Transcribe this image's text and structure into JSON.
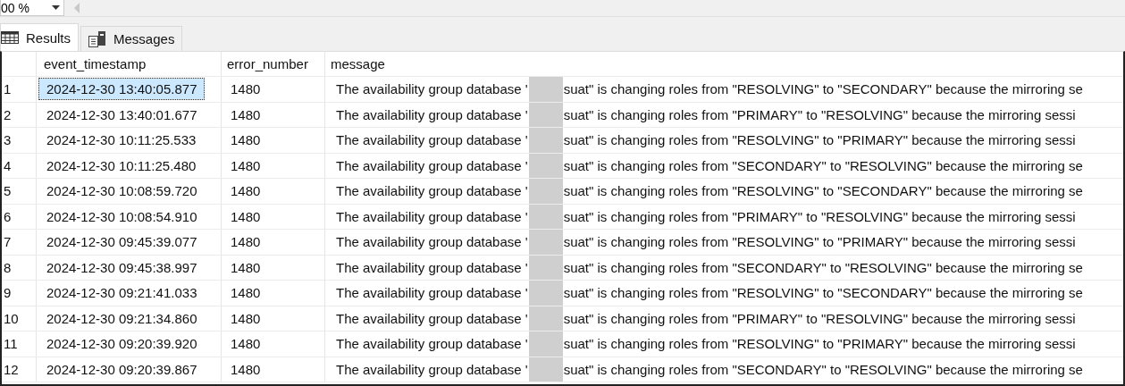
{
  "toolbar": {
    "zoom": "00 %"
  },
  "tabs": [
    {
      "label": "Results",
      "kind": "grid",
      "selected": true
    },
    {
      "label": "Messages",
      "kind": "messages",
      "selected": false
    }
  ],
  "table": {
    "columns": [
      "event_timestamp",
      "error_number",
      "message"
    ],
    "rows": [
      {
        "num": "1",
        "event_timestamp": "2024-12-30 13:40:05.877",
        "error_number": "1480",
        "message_start": "The availability group database '",
        "message_end": "suat\" is changing roles from \"RESOLVING\" to \"SECONDARY\" because the mirroring se",
        "selected": true
      },
      {
        "num": "2",
        "event_timestamp": "2024-12-30 13:40:01.677",
        "error_number": "1480",
        "message_start": "The availability group database '",
        "message_end": "suat\" is changing roles from \"PRIMARY\" to \"RESOLVING\" because the mirroring sessi",
        "selected": false
      },
      {
        "num": "3",
        "event_timestamp": "2024-12-30 10:11:25.533",
        "error_number": "1480",
        "message_start": "The availability group database '",
        "message_end": "suat\" is changing roles from \"RESOLVING\" to \"PRIMARY\" because the mirroring sessi",
        "selected": false
      },
      {
        "num": "4",
        "event_timestamp": "2024-12-30 10:11:25.480",
        "error_number": "1480",
        "message_start": "The availability group database '",
        "message_end": "suat\" is changing roles from \"SECONDARY\" to \"RESOLVING\" because the mirroring se",
        "selected": false
      },
      {
        "num": "5",
        "event_timestamp": "2024-12-30 10:08:59.720",
        "error_number": "1480",
        "message_start": "The availability group database '",
        "message_end": "suat\" is changing roles from \"RESOLVING\" to \"SECONDARY\" because the mirroring se",
        "selected": false
      },
      {
        "num": "6",
        "event_timestamp": "2024-12-30 10:08:54.910",
        "error_number": "1480",
        "message_start": "The availability group database '",
        "message_end": "suat\" is changing roles from \"PRIMARY\" to \"RESOLVING\" because the mirroring sessi",
        "selected": false
      },
      {
        "num": "7",
        "event_timestamp": "2024-12-30 09:45:39.077",
        "error_number": "1480",
        "message_start": "The availability group database '",
        "message_end": "suat\" is changing roles from \"RESOLVING\" to \"PRIMARY\" because the mirroring sessi",
        "selected": false
      },
      {
        "num": "8",
        "event_timestamp": "2024-12-30 09:45:38.997",
        "error_number": "1480",
        "message_start": "The availability group database '",
        "message_end": "suat\" is changing roles from \"SECONDARY\" to \"RESOLVING\" because the mirroring se",
        "selected": false
      },
      {
        "num": "9",
        "event_timestamp": "2024-12-30 09:21:41.033",
        "error_number": "1480",
        "message_start": "The availability group database '",
        "message_end": "suat\" is changing roles from \"RESOLVING\" to \"SECONDARY\" because the mirroring se",
        "selected": false
      },
      {
        "num": "10",
        "event_timestamp": "2024-12-30 09:21:34.860",
        "error_number": "1480",
        "message_start": "The availability group database '",
        "message_end": "suat\" is changing roles from \"PRIMARY\" to \"RESOLVING\" because the mirroring sessi",
        "selected": false
      },
      {
        "num": "11",
        "event_timestamp": "2024-12-30 09:20:39.920",
        "error_number": "1480",
        "message_start": "The availability group database '",
        "message_end": "suat\" is changing roles from \"RESOLVING\" to \"PRIMARY\" because the mirroring sessi",
        "selected": false
      },
      {
        "num": "12",
        "event_timestamp": "2024-12-30 09:20:39.867",
        "error_number": "1480",
        "message_start": "The availability group database '",
        "message_end": "suat\" is changing roles from \"SECONDARY\" to \"RESOLVING\" because the mirroring se",
        "selected": false
      }
    ]
  }
}
